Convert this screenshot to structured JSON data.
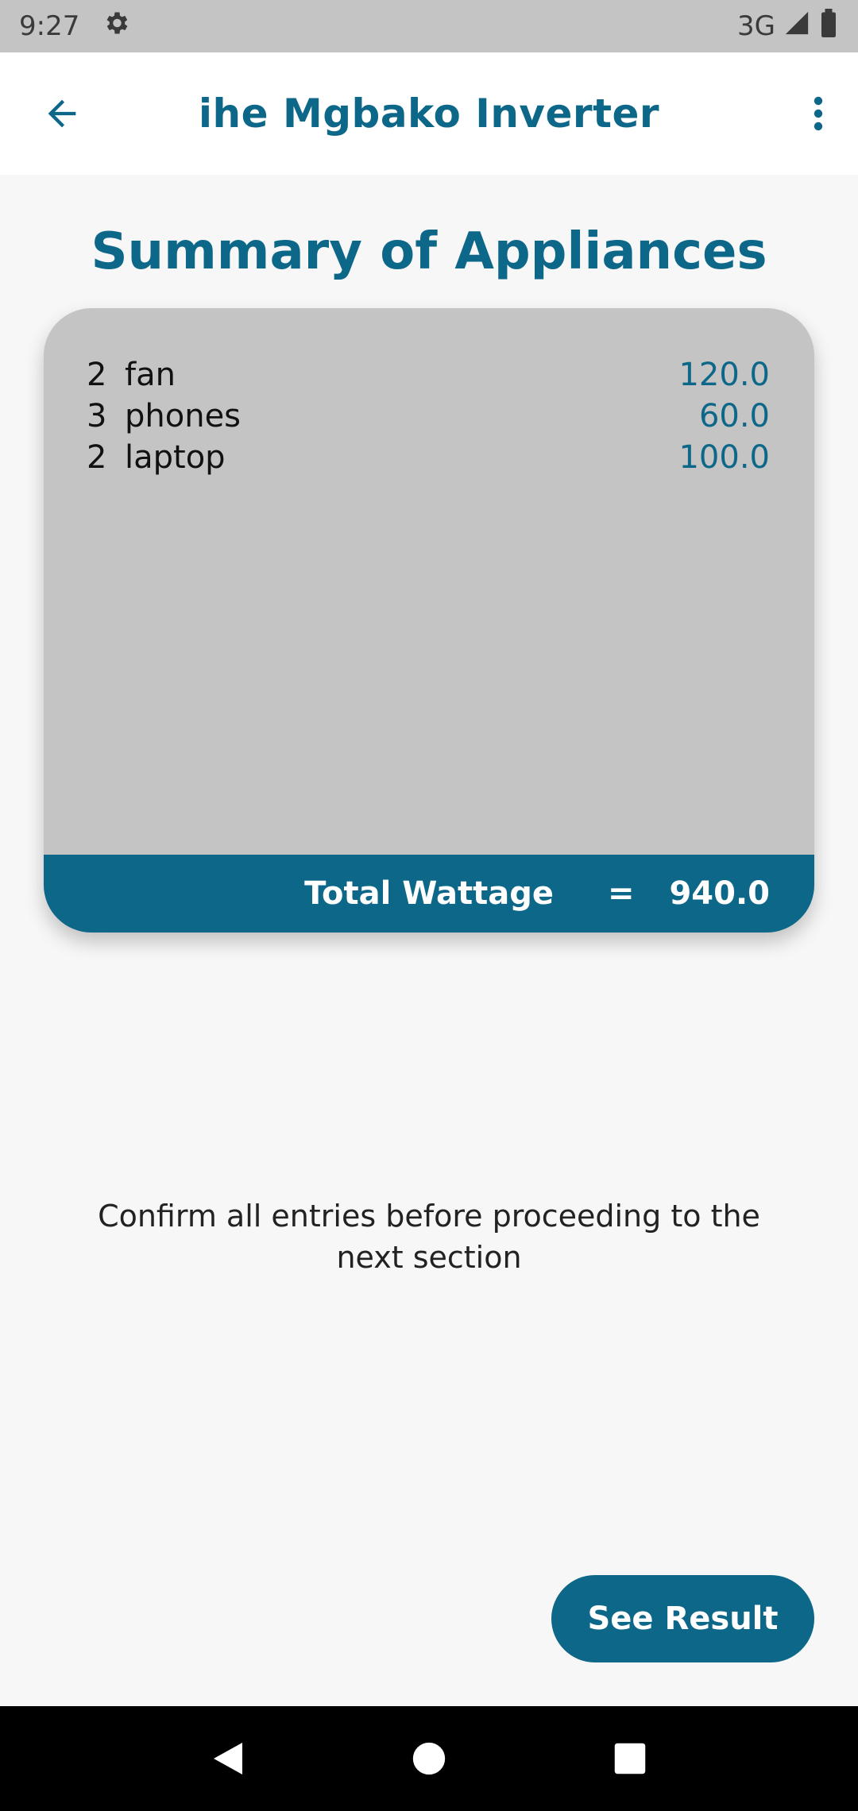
{
  "status_bar": {
    "time": "9:27",
    "network": "3G",
    "icons": [
      "settings-icon",
      "signal-icon",
      "battery-icon"
    ]
  },
  "app_bar": {
    "title": "ihe Mgbako Inverter",
    "back_icon": "arrow-left-icon",
    "menu_icon": "more-vertical-icon"
  },
  "heading": "Summary of Appliances",
  "appliances": [
    {
      "qty": "2",
      "name": "fan",
      "wattage": "120.0"
    },
    {
      "qty": "3",
      "name": "phones",
      "wattage": "60.0"
    },
    {
      "qty": "2",
      "name": "laptop",
      "wattage": "100.0"
    }
  ],
  "total": {
    "label": "Total Wattage",
    "equals": "=",
    "value": "940.0"
  },
  "note": "Confirm all entries before proceeding to the next section",
  "see_result_label": "See Result",
  "colors": {
    "primary": "#0d6789",
    "card": "#c4c4c4",
    "background": "#f7f7f7"
  }
}
